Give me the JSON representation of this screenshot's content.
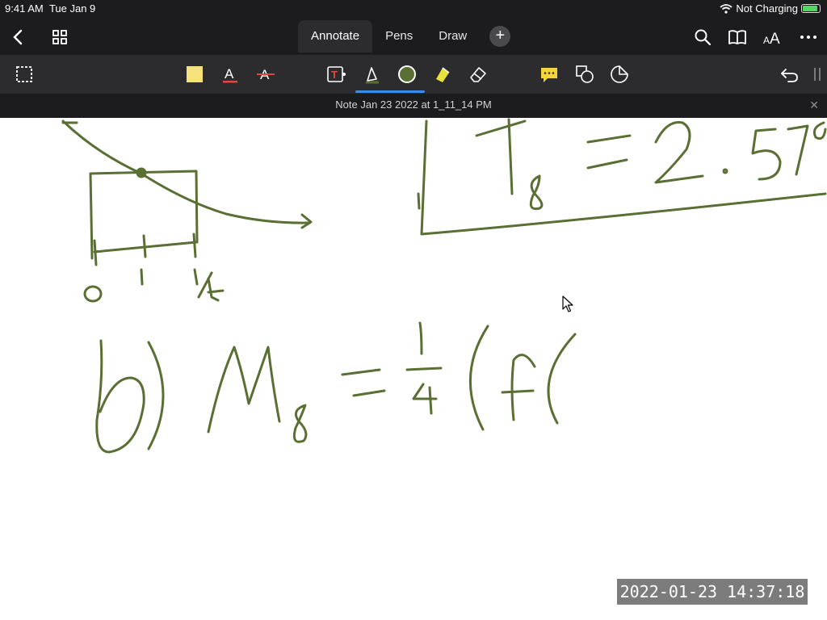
{
  "status": {
    "time": "9:41 AM",
    "date": "Tue Jan 9",
    "charging": "Not Charging"
  },
  "topbar": {
    "tabs": [
      {
        "label": "Annotate"
      },
      {
        "label": "Pens"
      },
      {
        "label": "Draw"
      }
    ],
    "add_label": "+",
    "icons": [
      "back-chevron-icon",
      "grid-icon",
      "search-icon",
      "book-icon",
      "text-size-icon",
      "more-icon"
    ]
  },
  "toolbar": {
    "tools": [
      "select-icon",
      "sticky-note-icon",
      "text-color-icon",
      "strikethrough-icon",
      "text-box-icon",
      "pen-icon",
      "color-icon",
      "highlighter-icon",
      "eraser-icon",
      "comment-icon",
      "shape-icon",
      "lasso-icon",
      "undo-icon",
      "collapse-icon"
    ],
    "pen_color": "#5a6f34"
  },
  "note": {
    "title": "Note Jan 23 2022 at 1_11_14 PM",
    "close": "✕"
  },
  "overlay": {
    "timestamp": "2022-01-23  14:37:18"
  },
  "ink_color": "#5a6f34"
}
